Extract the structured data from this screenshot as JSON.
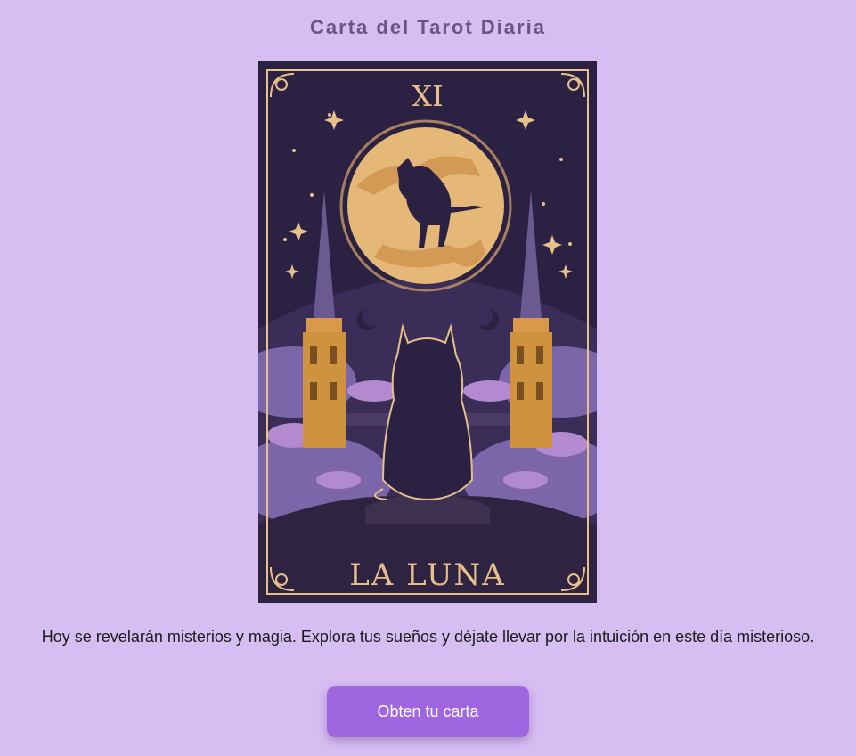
{
  "header": {
    "title": "Carta del Tarot Diaria"
  },
  "card": {
    "numeral": "XI",
    "name": "LA LUNA"
  },
  "reading": {
    "text": "Hoy se revelarán misterios y magia. Explora tus sueños y déjate llevar por la intuición en este día misterioso."
  },
  "actions": {
    "draw_label": "Obten tu carta"
  },
  "colors": {
    "background": "#d6bdf2",
    "button": "#a066e0",
    "card_dark": "#2a2040",
    "card_gold": "#e8c08a",
    "moon": "#e6b878"
  }
}
